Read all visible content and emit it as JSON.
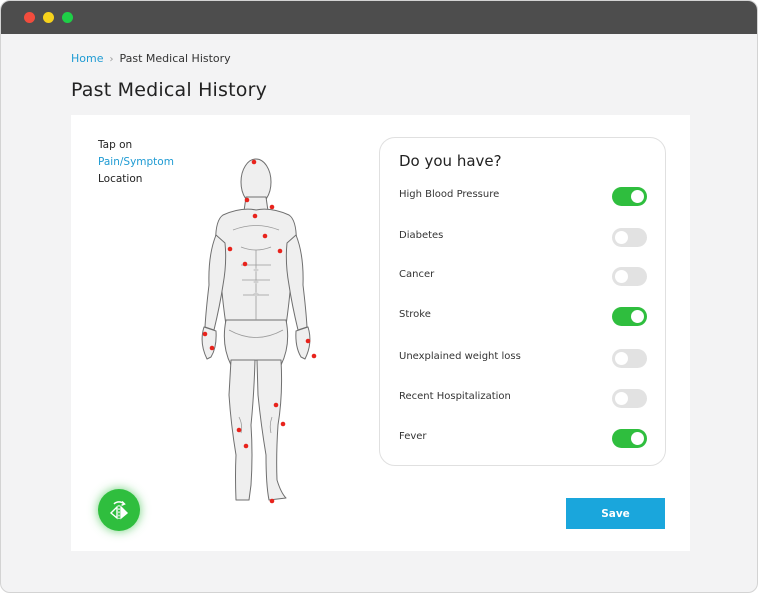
{
  "window": {
    "controls": [
      "close",
      "minimize",
      "maximize"
    ]
  },
  "breadcrumb": {
    "home": "Home",
    "current": "Past Medical History"
  },
  "page_title": "Past Medical History",
  "tap_hint": {
    "line1": "Tap on",
    "line2": "Pain/Symptom",
    "line3": "Location"
  },
  "panel": {
    "title": "Do you have?",
    "conditions": [
      {
        "label": "High Blood Pressure",
        "on": true
      },
      {
        "label": "Diabetes",
        "on": false
      },
      {
        "label": "Cancer",
        "on": false
      },
      {
        "label": "Stroke",
        "on": true
      },
      {
        "label": "Unexplained weight loss",
        "on": false
      },
      {
        "label": "Recent Hospitalization",
        "on": false
      },
      {
        "label": "Fever",
        "on": true
      }
    ]
  },
  "save_label": "Save",
  "colors": {
    "accent": "#1f9bd3",
    "toggle_on": "#2fbe3e",
    "toggle_off": "#e2e2e2",
    "marker": "#e8231c",
    "save": "#1aa6dc"
  },
  "icons": {
    "flip": "flip-body-icon",
    "marker": "pain-point-marker"
  }
}
